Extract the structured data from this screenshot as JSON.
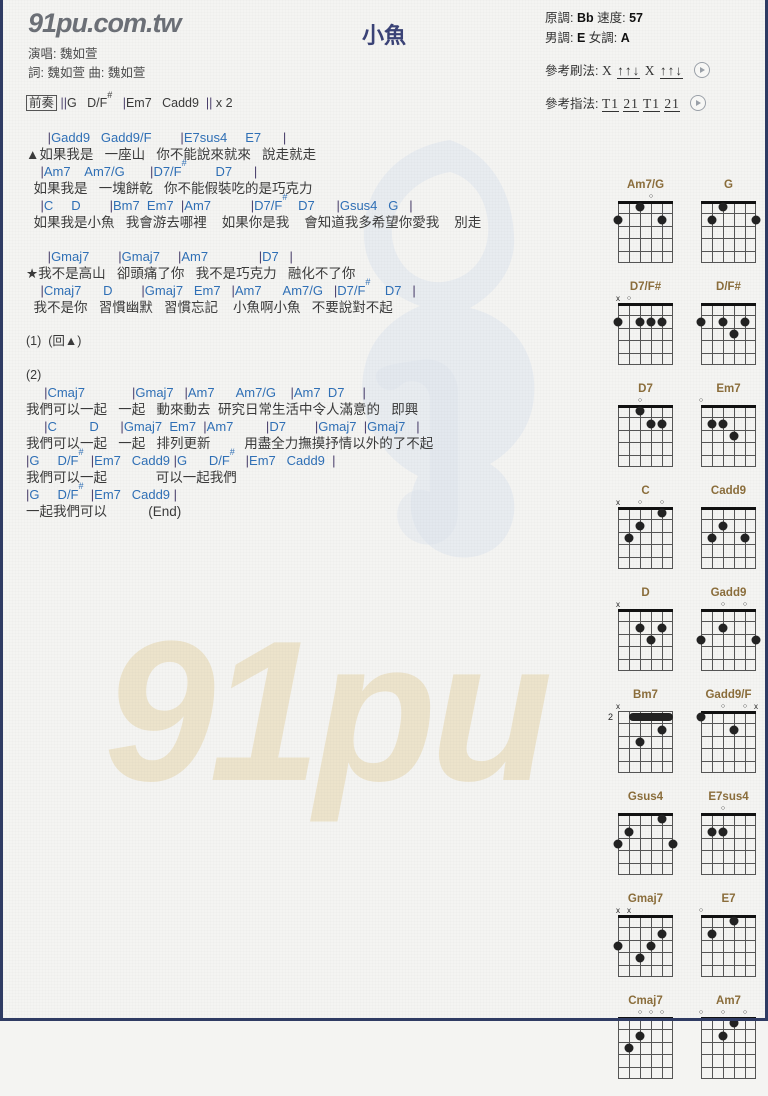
{
  "site": {
    "logo": "91pu.com.tw"
  },
  "header": {
    "title": "小魚",
    "credits": [
      "演唱: 魏如萱",
      "詞: 魏如萱   曲: 魏如萱"
    ],
    "meta": {
      "original_key_label": "原調:",
      "original_key": "Bb",
      "tempo_label": "速度:",
      "tempo": "57",
      "male_key_label": "男調:",
      "male_key": "E",
      "female_key_label": "女調:",
      "female_key": "A",
      "strum_label": "參考刷法:",
      "strum_pattern": "X ↑↑↓ X ↑↑↓",
      "fingerstyle_label": "參考指法:",
      "fingerstyle_pattern": "T1 21 T1 21"
    }
  },
  "sheet": {
    "lines": [
      {
        "type": "plain",
        "text": "[前奏] ||G   D/F#   |Em7   Cadd9  || x 2"
      },
      {
        "type": "blank",
        "text": ""
      },
      {
        "type": "chords",
        "text": "      |Gadd9   Gadd9/F        |E7sus4     E7      |"
      },
      {
        "type": "lyrics",
        "text": "▲如果我是   一座山   你不能說來就來   說走就走"
      },
      {
        "type": "chords",
        "text": "    |Am7    Am7/G       |D7/F#        D7      |"
      },
      {
        "type": "lyrics",
        "text": "  如果我是   一塊餅乾   你不能假裝吃的是巧克力"
      },
      {
        "type": "chords",
        "text": "    |C     D        |Bm7  Em7  |Am7           |D7/F#   D7      |Gsus4   G   |"
      },
      {
        "type": "lyrics",
        "text": "  如果我是小魚   我會游去哪裡    如果你是我    會知道我多希望你愛我    別走"
      },
      {
        "type": "blank",
        "text": ""
      },
      {
        "type": "chords",
        "text": "      |Gmaj7        |Gmaj7     |Am7              |D7   |"
      },
      {
        "type": "lyrics",
        "text": "★我不是高山   卻頭痛了你   我不是巧克力   融化不了你"
      },
      {
        "type": "chords",
        "text": "    |Cmaj7      D        |Gmaj7   Em7   |Am7      Am7/G   |D7/F#    D7   |"
      },
      {
        "type": "lyrics",
        "text": "  我不是你   習慣幽默   習慣忘記    小魚啊小魚   不要說對不起"
      },
      {
        "type": "blank",
        "text": ""
      },
      {
        "type": "plain",
        "text": "(1)  (回▲)"
      },
      {
        "type": "blank",
        "text": ""
      },
      {
        "type": "plain",
        "text": "(2)"
      },
      {
        "type": "chords",
        "text": "     |Cmaj7             |Gmaj7   |Am7      Am7/G    |Am7  D7     |"
      },
      {
        "type": "lyrics",
        "text": "我們可以一起   一起   動來動去  研究日常生活中令人滿意的   即興"
      },
      {
        "type": "chords",
        "text": "     |C         D      |Gmaj7  Em7  |Am7         |D7        |Gmaj7  |Gmaj7   |"
      },
      {
        "type": "lyrics",
        "text": "我們可以一起   一起   排列更新         用盡全力撫摸抒情以外的了不起"
      },
      {
        "type": "chords",
        "text": "|G     D/F#  |Em7   Cadd9 |G      D/F#   |Em7   Cadd9  |"
      },
      {
        "type": "lyrics",
        "text": "我們可以一起             可以一起我們"
      },
      {
        "type": "chords",
        "text": "|G     D/F#  |Em7   Cadd9 |"
      },
      {
        "type": "lyrics",
        "text": "一起我們可以           (End)"
      }
    ]
  },
  "chord_diagrams": [
    {
      "name": "Am7/G",
      "markers": [
        "",
        "",
        "",
        "o",
        "",
        ""
      ],
      "dots": [
        [
          6,
          2
        ],
        [
          4,
          1
        ],
        [
          2,
          2
        ]
      ],
      "barre": null,
      "fret_start": ""
    },
    {
      "name": "G",
      "markers": [
        "",
        "",
        "",
        "",
        "",
        ""
      ],
      "dots": [
        [
          5,
          2
        ],
        [
          4,
          1
        ],
        [
          1,
          2
        ]
      ],
      "barre": null,
      "fret_start": ""
    },
    {
      "name": "D7/F#",
      "markers": [
        "x",
        "o",
        "",
        "",
        "",
        ""
      ],
      "dots": [
        [
          6,
          2
        ],
        [
          4,
          2
        ],
        [
          3,
          2
        ],
        [
          2,
          2
        ]
      ],
      "barre": null,
      "fret_start": ""
    },
    {
      "name": "D/F#",
      "markers": [
        "",
        "",
        "",
        "",
        "",
        ""
      ],
      "dots": [
        [
          6,
          2
        ],
        [
          4,
          2
        ],
        [
          3,
          3
        ],
        [
          2,
          2
        ]
      ],
      "barre": null,
      "fret_start": ""
    },
    {
      "name": "D7",
      "markers": [
        "",
        "",
        "o",
        "",
        "",
        ""
      ],
      "dots": [
        [
          4,
          1
        ],
        [
          3,
          2
        ],
        [
          2,
          2
        ]
      ],
      "barre": null,
      "fret_start": ""
    },
    {
      "name": "Em7",
      "markers": [
        "o",
        "",
        "",
        "",
        "",
        ""
      ],
      "dots": [
        [
          5,
          2
        ],
        [
          4,
          2
        ],
        [
          3,
          3
        ]
      ],
      "barre": null,
      "fret_start": ""
    },
    {
      "name": "C",
      "markers": [
        "x",
        "",
        "o",
        "",
        "o",
        ""
      ],
      "dots": [
        [
          5,
          3
        ],
        [
          4,
          2
        ],
        [
          2,
          1
        ]
      ],
      "barre": null,
      "fret_start": ""
    },
    {
      "name": "Cadd9",
      "markers": [
        "",
        "",
        "",
        "",
        "",
        ""
      ],
      "dots": [
        [
          5,
          3
        ],
        [
          4,
          2
        ],
        [
          2,
          3
        ]
      ],
      "barre": null,
      "fret_start": ""
    },
    {
      "name": "D",
      "markers": [
        "x",
        "",
        "",
        "",
        "",
        ""
      ],
      "dots": [
        [
          4,
          2
        ],
        [
          3,
          3
        ],
        [
          2,
          2
        ]
      ],
      "barre": null,
      "fret_start": ""
    },
    {
      "name": "Gadd9",
      "markers": [
        "",
        "",
        "o",
        "",
        "o",
        ""
      ],
      "dots": [
        [
          6,
          3
        ],
        [
          4,
          2
        ],
        [
          1,
          3
        ]
      ],
      "barre": null,
      "fret_start": ""
    },
    {
      "name": "Bm7",
      "markers": [
        "x",
        "",
        "",
        "",
        "",
        ""
      ],
      "dots": [
        [
          4,
          3
        ],
        [
          2,
          2
        ]
      ],
      "barre": {
        "fret": 1,
        "from": 5,
        "to": 1
      },
      "fret_start": "2"
    },
    {
      "name": "Gadd9/F",
      "markers": [
        "",
        "",
        "o",
        "",
        "o",
        "x"
      ],
      "dots": [
        [
          6,
          1
        ],
        [
          3,
          2
        ]
      ],
      "barre": null,
      "fret_start": ""
    },
    {
      "name": "Gsus4",
      "markers": [
        "",
        "",
        "",
        "",
        "",
        ""
      ],
      "dots": [
        [
          6,
          3
        ],
        [
          5,
          2
        ],
        [
          2,
          1
        ],
        [
          1,
          3
        ]
      ],
      "barre": null,
      "fret_start": ""
    },
    {
      "name": "E7sus4",
      "markers": [
        "",
        "",
        "o",
        "",
        "",
        ""
      ],
      "dots": [
        [
          5,
          2
        ],
        [
          4,
          2
        ]
      ],
      "barre": null,
      "fret_start": ""
    },
    {
      "name": "Gmaj7",
      "markers": [
        "x",
        "x",
        "",
        "",
        "",
        ""
      ],
      "dots": [
        [
          6,
          3
        ],
        [
          3,
          3
        ],
        [
          2,
          2
        ],
        [
          4,
          4
        ]
      ],
      "barre": null,
      "fret_start": ""
    },
    {
      "name": "E7",
      "markers": [
        "o",
        "",
        "",
        "",
        "",
        ""
      ],
      "dots": [
        [
          5,
          2
        ],
        [
          3,
          1
        ]
      ],
      "barre": null,
      "fret_start": ""
    },
    {
      "name": "Cmaj7",
      "markers": [
        "",
        "",
        "o",
        "o",
        "o",
        ""
      ],
      "dots": [
        [
          5,
          3
        ],
        [
          4,
          2
        ]
      ],
      "barre": null,
      "fret_start": ""
    },
    {
      "name": "Am7",
      "markers": [
        "o",
        "",
        "o",
        "",
        "o",
        ""
      ],
      "dots": [
        [
          4,
          2
        ],
        [
          3,
          1
        ]
      ],
      "barre": null,
      "fret_start": ""
    }
  ],
  "colors": {
    "chord_blue": "#2f6fb5",
    "title_navy": "#3a4276",
    "diagram_name": "#8a6d3b",
    "watermark_beige": "#ece3cb"
  }
}
